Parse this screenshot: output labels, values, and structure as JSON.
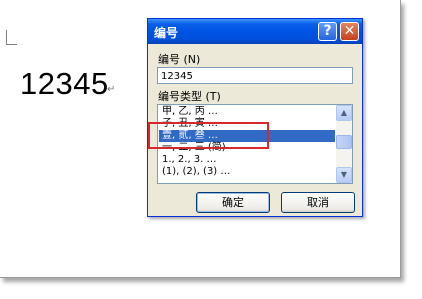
{
  "document": {
    "text": "12345",
    "paragraph_mark": "↵"
  },
  "dialog": {
    "title": "编号",
    "help_label": "?",
    "close_label": "✕",
    "number_label": "编号 (N)",
    "number_value": "12345",
    "type_label": "编号类型 (T)",
    "list_items": [
      "甲, 乙, 丙 …",
      "子, 丑, 寅 …",
      "壹, 贰, 叁 …",
      "一, 二, 三 (简)",
      "1., 2., 3. …",
      "(1), (2), (3) …"
    ],
    "selected_index": 2,
    "ok_label": "确定",
    "cancel_label": "取消",
    "scroll_up": "▲",
    "scroll_down": "▼"
  },
  "colors": {
    "titlebar": "#0054e3",
    "selection": "#316ac5",
    "highlight_box": "#d7282c",
    "dialog_bg": "#ece9d8"
  }
}
